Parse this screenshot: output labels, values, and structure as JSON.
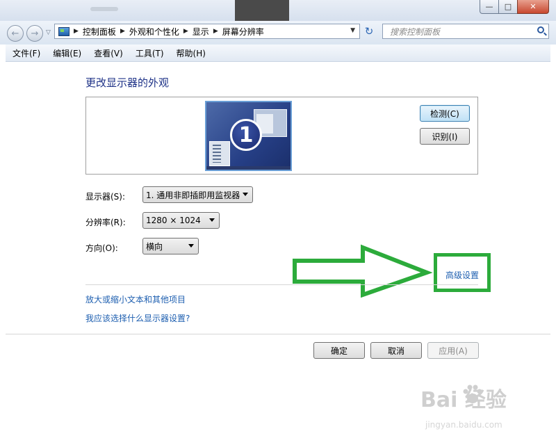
{
  "window": {
    "title_controls": {
      "minimize": "—",
      "maximize": "□",
      "close": "✕"
    }
  },
  "navbar": {
    "back": "←",
    "forward": "→",
    "breadcrumb": [
      "控制面板",
      "外观和个性化",
      "显示",
      "屏幕分辨率"
    ],
    "refresh": "↻",
    "search_placeholder": "搜索控制面板"
  },
  "menu": [
    "文件(F)",
    "编辑(E)",
    "查看(V)",
    "工具(T)",
    "帮助(H)"
  ],
  "main": {
    "heading": "更改显示器的外观",
    "monitor_number": "1",
    "detect_button": "检测(C)",
    "identify_button": "识别(I)",
    "display": {
      "label": "显示器(S):",
      "value": "1. 通用非即插即用监视器"
    },
    "resolution": {
      "label": "分辨率(R):",
      "value": "1280 × 1024"
    },
    "orientation": {
      "label": "方向(O):",
      "value": "横向"
    },
    "advanced_link": "高级设置",
    "link_text_size": "放大或缩小文本和其他项目",
    "link_which_setting": "我应该选择什么显示器设置?"
  },
  "footer": {
    "ok": "确定",
    "cancel": "取消",
    "apply": "应用(A)"
  },
  "annotation": {
    "color": "#2cab3b"
  },
  "watermark": {
    "brand": "Bai  经验",
    "url": "jingyan.baidu.com"
  }
}
